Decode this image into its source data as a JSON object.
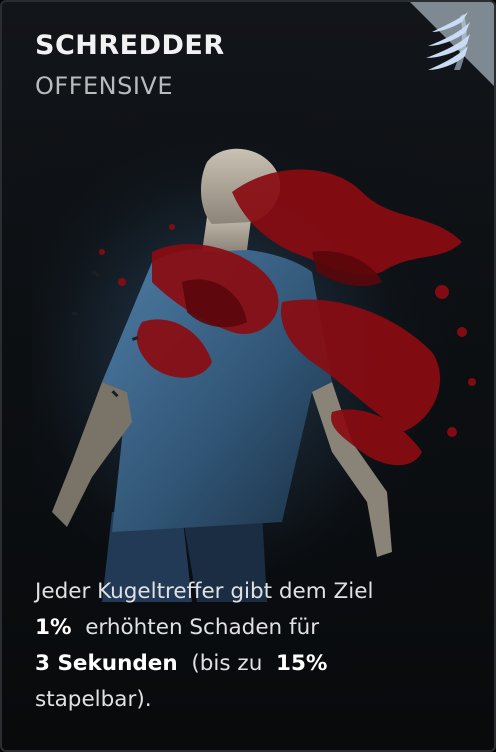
{
  "card": {
    "title": "SCHREDDER",
    "category": "OFFENSIVE",
    "emblem_icon": "wing-icon",
    "description": {
      "line1": "Jeder Kugeltreffer gibt dem Ziel",
      "value1": "1%",
      "line2_rest": "erhöhten Schaden für",
      "duration": "3 Sekunden",
      "line3_mid": "(bis zu",
      "max_stack": "15%",
      "line4": "stapelbar)."
    }
  },
  "colors": {
    "accent_blood": "#8a0c12",
    "corner_badge": "#8c969e",
    "emblem": "#bcd2ee"
  }
}
